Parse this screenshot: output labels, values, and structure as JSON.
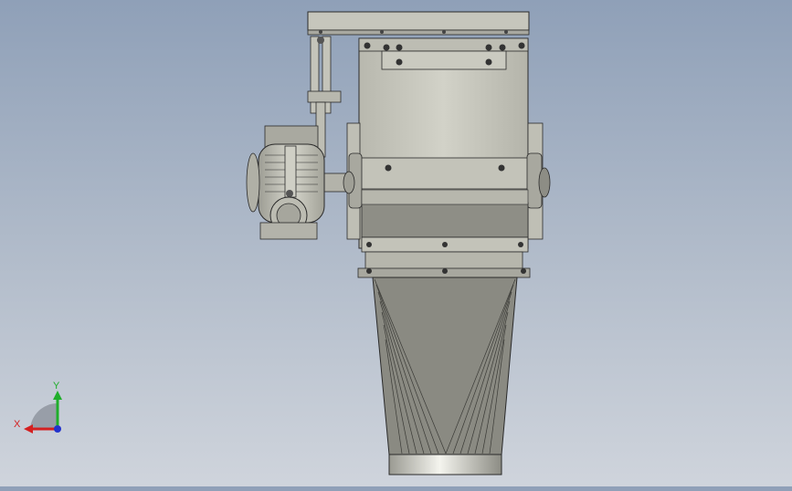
{
  "viewport": {
    "background_top": "#8fa0b8",
    "background_bottom": "#cfd4dc"
  },
  "model": {
    "body_color": "#c9c9bf",
    "edge_color": "#2a2a2a",
    "shadow_color": "#7f7f76",
    "cone_color": "#8a8a82"
  },
  "triad": {
    "x_label": "X",
    "y_label": "Y",
    "x_color": "#d42020",
    "y_color": "#1fae2b",
    "z_color": "#2233cc"
  }
}
